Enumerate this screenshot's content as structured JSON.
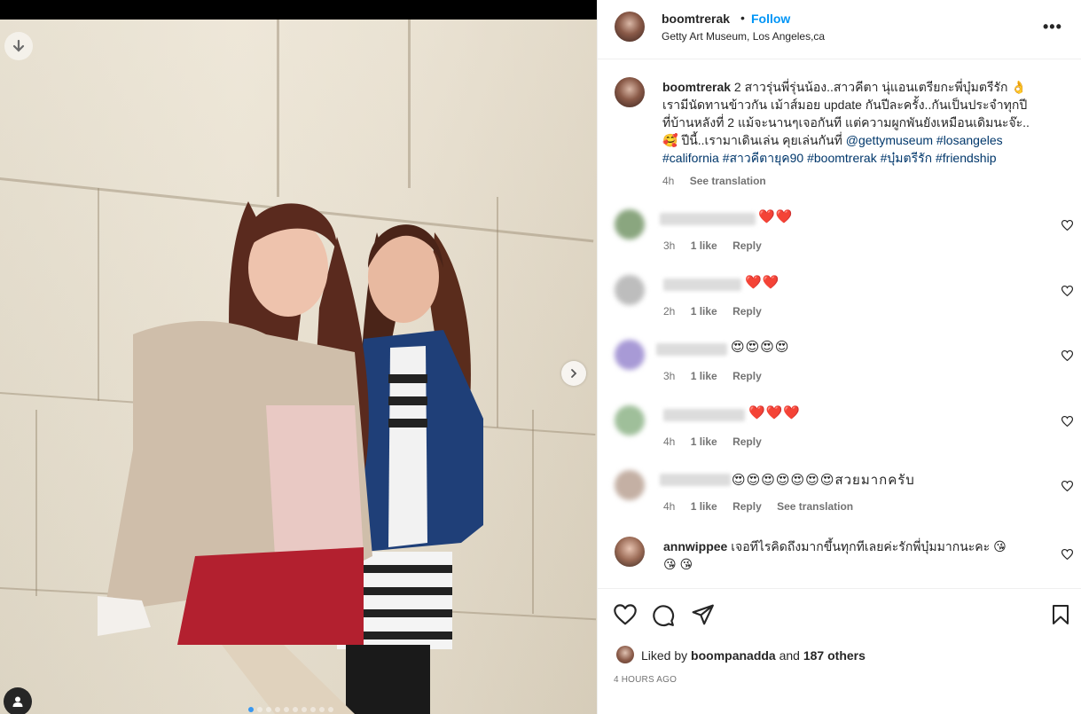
{
  "post": {
    "username": "boomtrerak",
    "separator": "•",
    "follow_label": "Follow",
    "location": "Getty Art Museum, Los Angeles,ca",
    "more_label": "•••"
  },
  "caption": {
    "username": "boomtrerak",
    "text": "2 สาวรุ่นพี่รุ่นน้อง..สาวคีตา นุ่แอนเตรียกะพี่บุ๋มตรีรัก 👌เรามีนัดทานข้าวกัน เม้าส์มอย update กันปีละครั้ง..กันเป็นประจำทุกปีที่บ้านหลังที่ 2 แม้จะนานๆเจอกันที แต่ความผูกพันยังเหมือนเดิมนะจ๊ะ..🥰 ปีนี้..เรามาเดินเล่น คุยเล่นกันที่",
    "mention": "@gettymuseum",
    "hashtags": "#losangeles #california #สาวคีตายุค90 #boomtrerak #บุ๋มตรีรัก #friendship",
    "time": "4h",
    "see_translation": "See translation"
  },
  "comments": [
    {
      "emoji": "❤️❤️",
      "time": "3h",
      "likes": "1 like",
      "reply": "Reply",
      "avatar_color": "#8aa67f"
    },
    {
      "emoji": "❤️❤️",
      "time": "2h",
      "likes": "1 like",
      "reply": "Reply",
      "avatar_color": "#bdbdbd"
    },
    {
      "emoji": "😍😍😍😍",
      "time": "3h",
      "likes": "1 like",
      "reply": "Reply",
      "avatar_color": "#a89ad6"
    },
    {
      "emoji": "❤️❤️❤️",
      "time": "4h",
      "likes": "1 like",
      "reply": "Reply",
      "avatar_color": "#9fbf9a"
    },
    {
      "emoji": "😍😍😍😍😍😍😍สวยมากครับ",
      "time": "4h",
      "likes": "1 like",
      "reply": "Reply",
      "see_translation": "See translation",
      "avatar_color": "#c4b0a4"
    }
  ],
  "last_comment": {
    "username": "annwippee",
    "text": "เจอทีไรคิดถึงมากขึ้นทุกทีเลยค่ะรักพี่บุ๋มมากนะคะ 😘",
    "text2": "😘 😘"
  },
  "likes": {
    "prefix": "Liked by",
    "user": "boompanadda",
    "connector": "and",
    "others": "187 others"
  },
  "posted": "4 HOURS AGO",
  "colors": {
    "accent": "#0095f6",
    "link": "#00376b",
    "muted": "#737373"
  },
  "icons": [
    "download-icon",
    "chevron-right-icon",
    "user-tag-icon",
    "more-icon",
    "heart-icon",
    "comment-icon",
    "share-icon",
    "bookmark-icon"
  ]
}
